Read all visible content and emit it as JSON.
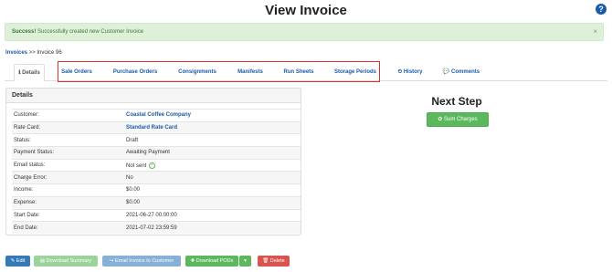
{
  "page": {
    "title": "View Invoice",
    "help_icon": "?"
  },
  "alert": {
    "strong": "Success!",
    "message": " Successfully created new Customer Invoice",
    "close": "×"
  },
  "breadcrumb": {
    "link": "Invoices",
    "separator": " >> ",
    "current": "Invoice 96"
  },
  "tabs": [
    {
      "label": "ℹ Details",
      "active": true
    },
    {
      "label": "Sale Orders"
    },
    {
      "label": "Purchase Orders"
    },
    {
      "label": "Consignments"
    },
    {
      "label": "Manifests"
    },
    {
      "label": "Run Sheets"
    },
    {
      "label": "Storage Periods"
    },
    {
      "label": "⏲ History"
    },
    {
      "label": "💬 Comments"
    }
  ],
  "details": {
    "heading": "Details",
    "rows": [
      {
        "label": "Customer:",
        "value": "Coastal Coffee Company"
      },
      {
        "label": "Rate Card:",
        "value": "Standard Rate Card"
      },
      {
        "label": "Status:",
        "value": "Draft"
      },
      {
        "label": "Payment Status:",
        "value": "Awaiting Payment"
      },
      {
        "label": "Email status:",
        "value": "Not sent"
      },
      {
        "label": "Charge Error:",
        "value": "No"
      },
      {
        "label": "Income:",
        "value": "$0.00"
      },
      {
        "label": "Expense:",
        "value": "$0.00"
      },
      {
        "label": "Start Date:",
        "value": "2021-06-27 00:00:00"
      },
      {
        "label": "End Date:",
        "value": "2021-07-02 23:59:59"
      }
    ]
  },
  "next_step": {
    "title": "Next Step",
    "button": "✿ Sum Charges"
  },
  "actions": {
    "edit": "✎ Edit",
    "download_summary": "▤ Download Summary",
    "email_invoice": "↪ Email Invoice to Customer",
    "download_pods": "✚ Download PODs",
    "caret": "▾",
    "delete": "🗑 Delete"
  },
  "colors": {
    "link": "#1a5aa8",
    "success_bg": "#dff0d8",
    "highlight": "#d9302a"
  }
}
